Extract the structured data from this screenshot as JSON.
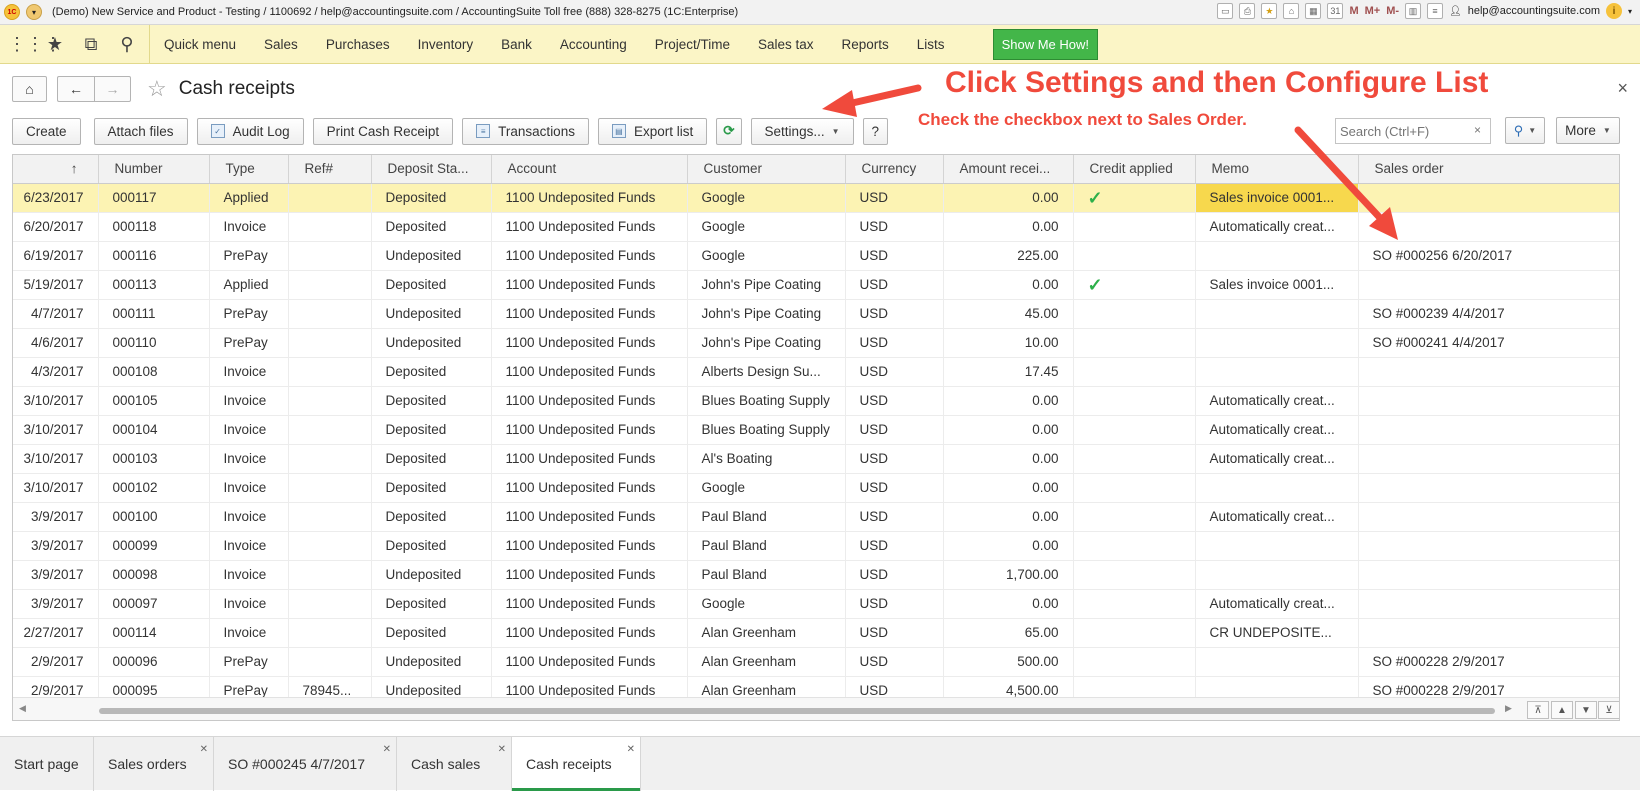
{
  "window": {
    "title": "(Demo) New Service and Product - Testing / 1100692 / help@accountingsuite.com / AccountingSuite Toll free (888) 328-8275   (1C:Enterprise)",
    "user": "help@accountingsuite.com",
    "m_labels": [
      "M",
      "M+",
      "M-"
    ]
  },
  "nav": {
    "items": [
      "Quick menu",
      "Sales",
      "Purchases",
      "Inventory",
      "Bank",
      "Accounting",
      "Project/Time",
      "Sales tax",
      "Reports",
      "Lists"
    ],
    "show_me": "Show Me How!"
  },
  "page": {
    "title": "Cash receipts"
  },
  "annotations": {
    "headline": "Click Settings and then Configure List",
    "sub": "Check the checkbox next to Sales Order."
  },
  "toolbar": {
    "create": "Create",
    "attach": "Attach files",
    "audit": "Audit Log",
    "print": "Print Cash Receipt",
    "transactions": "Transactions",
    "export": "Export list",
    "settings": "Settings...",
    "help": "?",
    "search_placeholder": "Search (Ctrl+F)",
    "more": "More"
  },
  "table": {
    "columns": [
      "↑",
      "Number",
      "Type",
      "Ref#",
      "Deposit Sta...",
      "Account",
      "Customer",
      "Currency",
      "Amount recei...",
      "Credit applied",
      "Memo",
      "Sales order"
    ],
    "rows": [
      {
        "date": "6/23/2017",
        "number": "000117",
        "type": "Applied",
        "ref": "",
        "deposit": "Deposited",
        "account": "1100 Undeposited Funds",
        "customer": "Google",
        "currency": "USD",
        "amount": "0.00",
        "credit": true,
        "memo": "Sales invoice 0001...",
        "so": ""
      },
      {
        "date": "6/20/2017",
        "number": "000118",
        "type": "Invoice",
        "ref": "",
        "deposit": "Deposited",
        "account": "1100 Undeposited Funds",
        "customer": "Google",
        "currency": "USD",
        "amount": "0.00",
        "credit": false,
        "memo": "Automatically creat...",
        "so": ""
      },
      {
        "date": "6/19/2017",
        "number": "000116",
        "type": "PrePay",
        "ref": "",
        "deposit": "Undeposited",
        "account": "1100 Undeposited Funds",
        "customer": "Google",
        "currency": "USD",
        "amount": "225.00",
        "credit": false,
        "memo": "",
        "so": "SO #000256 6/20/2017"
      },
      {
        "date": "5/19/2017",
        "number": "000113",
        "type": "Applied",
        "ref": "",
        "deposit": "Deposited",
        "account": "1100 Undeposited Funds",
        "customer": "John's Pipe Coating",
        "currency": "USD",
        "amount": "0.00",
        "credit": true,
        "memo": "Sales invoice 0001...",
        "so": ""
      },
      {
        "date": "4/7/2017",
        "number": "000111",
        "type": "PrePay",
        "ref": "",
        "deposit": "Undeposited",
        "account": "1100 Undeposited Funds",
        "customer": "John's Pipe Coating",
        "currency": "USD",
        "amount": "45.00",
        "credit": false,
        "memo": "",
        "so": "SO #000239 4/4/2017"
      },
      {
        "date": "4/6/2017",
        "number": "000110",
        "type": "PrePay",
        "ref": "",
        "deposit": "Undeposited",
        "account": "1100 Undeposited Funds",
        "customer": "John's Pipe Coating",
        "currency": "USD",
        "amount": "10.00",
        "credit": false,
        "memo": "",
        "so": "SO #000241 4/4/2017"
      },
      {
        "date": "4/3/2017",
        "number": "000108",
        "type": "Invoice",
        "ref": "",
        "deposit": "Deposited",
        "account": "1100 Undeposited Funds",
        "customer": "Alberts Design Su...",
        "currency": "USD",
        "amount": "17.45",
        "credit": false,
        "memo": "",
        "so": ""
      },
      {
        "date": "3/10/2017",
        "number": "000105",
        "type": "Invoice",
        "ref": "",
        "deposit": "Deposited",
        "account": "1100 Undeposited Funds",
        "customer": "Blues Boating Supply",
        "currency": "USD",
        "amount": "0.00",
        "credit": false,
        "memo": "Automatically creat...",
        "so": ""
      },
      {
        "date": "3/10/2017",
        "number": "000104",
        "type": "Invoice",
        "ref": "",
        "deposit": "Deposited",
        "account": "1100 Undeposited Funds",
        "customer": "Blues Boating Supply",
        "currency": "USD",
        "amount": "0.00",
        "credit": false,
        "memo": "Automatically creat...",
        "so": ""
      },
      {
        "date": "3/10/2017",
        "number": "000103",
        "type": "Invoice",
        "ref": "",
        "deposit": "Deposited",
        "account": "1100 Undeposited Funds",
        "customer": "Al's Boating",
        "currency": "USD",
        "amount": "0.00",
        "credit": false,
        "memo": "Automatically creat...",
        "so": ""
      },
      {
        "date": "3/10/2017",
        "number": "000102",
        "type": "Invoice",
        "ref": "",
        "deposit": "Deposited",
        "account": "1100 Undeposited Funds",
        "customer": "Google",
        "currency": "USD",
        "amount": "0.00",
        "credit": false,
        "memo": "",
        "so": ""
      },
      {
        "date": "3/9/2017",
        "number": "000100",
        "type": "Invoice",
        "ref": "",
        "deposit": "Deposited",
        "account": "1100 Undeposited Funds",
        "customer": "Paul Bland",
        "currency": "USD",
        "amount": "0.00",
        "credit": false,
        "memo": "Automatically creat...",
        "so": ""
      },
      {
        "date": "3/9/2017",
        "number": "000099",
        "type": "Invoice",
        "ref": "",
        "deposit": "Deposited",
        "account": "1100 Undeposited Funds",
        "customer": "Paul Bland",
        "currency": "USD",
        "amount": "0.00",
        "credit": false,
        "memo": "",
        "so": ""
      },
      {
        "date": "3/9/2017",
        "number": "000098",
        "type": "Invoice",
        "ref": "",
        "deposit": "Undeposited",
        "account": "1100 Undeposited Funds",
        "customer": "Paul Bland",
        "currency": "USD",
        "amount": "1,700.00",
        "credit": false,
        "memo": "",
        "so": ""
      },
      {
        "date": "3/9/2017",
        "number": "000097",
        "type": "Invoice",
        "ref": "",
        "deposit": "Deposited",
        "account": "1100 Undeposited Funds",
        "customer": "Google",
        "currency": "USD",
        "amount": "0.00",
        "credit": false,
        "memo": "Automatically creat...",
        "so": ""
      },
      {
        "date": "2/27/2017",
        "number": "000114",
        "type": "Invoice",
        "ref": "",
        "deposit": "Deposited",
        "account": "1100 Undeposited Funds",
        "customer": "Alan Greenham",
        "currency": "USD",
        "amount": "65.00",
        "credit": false,
        "memo": "CR UNDEPOSITE...",
        "so": ""
      },
      {
        "date": "2/9/2017",
        "number": "000096",
        "type": "PrePay",
        "ref": "",
        "deposit": "Undeposited",
        "account": "1100 Undeposited Funds",
        "customer": "Alan Greenham",
        "currency": "USD",
        "amount": "500.00",
        "credit": false,
        "memo": "",
        "so": "SO #000228 2/9/2017"
      },
      {
        "date": "2/9/2017",
        "number": "000095",
        "type": "PrePay",
        "ref": "78945...",
        "deposit": "Undeposited",
        "account": "1100 Undeposited Funds",
        "customer": "Alan Greenham",
        "currency": "USD",
        "amount": "4,500.00",
        "credit": false,
        "memo": "",
        "so": "SO #000228 2/9/2017"
      }
    ]
  },
  "bottom_tabs": [
    "Start page",
    "Sales orders",
    "SO #000245 4/7/2017",
    "Cash sales",
    "Cash receipts"
  ],
  "colors": {
    "nav_bg": "#fbf5c6",
    "show_me": "#43b649",
    "annotation": "#f04a3c",
    "selected_row": "#fcf3b3",
    "check": "#2db04a",
    "active_tab": "#2a9a4a"
  }
}
